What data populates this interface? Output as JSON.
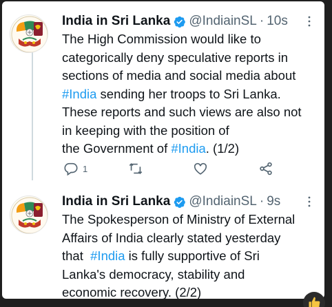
{
  "tweets": [
    {
      "author": "India in Sri Lanka",
      "handle": "@IndiainSL",
      "separator": "·",
      "time": "10s",
      "text_lines": [
        "The High Commission would like to",
        "categorically deny speculative reports in",
        "sections of media and social media about",
        [
          "#India",
          " sending her troops to Sri Lanka."
        ],
        "These reports and such views are also not",
        "in keeping with the position of",
        [
          "the Government of ",
          "#India",
          ".  (1/2)"
        ]
      ],
      "line4_hashtag": "#India",
      "line4_rest": " sending her troops to Sri Lanka.",
      "line7_pre": "the Government of ",
      "line7_hashtag": "#India",
      "line7_post": ".  (1/2)",
      "reply_count": "1",
      "icons": [
        "verified-icon",
        "more-icon",
        "reply-icon",
        "retweet-icon",
        "like-icon",
        "share-icon"
      ]
    },
    {
      "author": "India in Sri Lanka",
      "handle": "@IndiainSL",
      "separator": "·",
      "time": "9s",
      "line1": "The Spokesperson of Ministry of External",
      "line2": "Affairs of India clearly stated yesterday",
      "line3_pre": "that  ",
      "line3_hashtag": "#India",
      "line3_post": " is fully supportive of Sri",
      "line4": "Lanka's democracy, stability and",
      "line5": "economic recovery. (2/2)"
    }
  ],
  "colors": {
    "text": "#0f1419",
    "secondary": "#536471",
    "link": "#1d9bf0",
    "verified": "#1d9bf0"
  },
  "corner_badge_icon": "thumbs-up-icon"
}
